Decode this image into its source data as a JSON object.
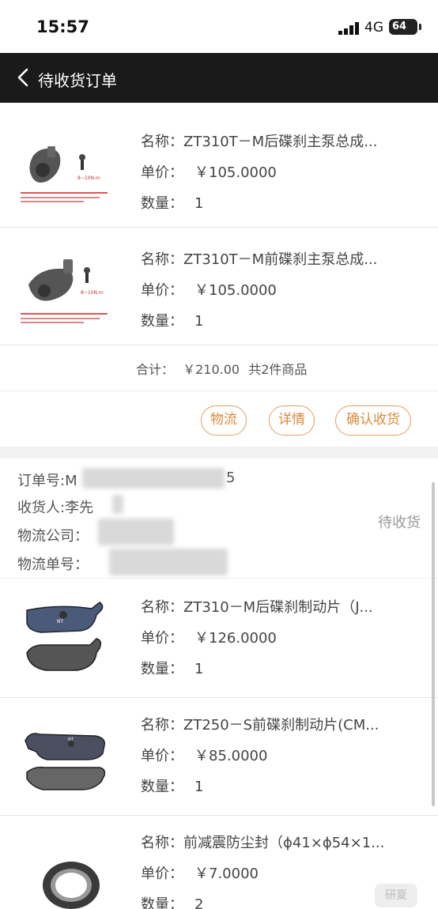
{
  "status_bar": {
    "time": "15:57",
    "network": "4G",
    "battery": "64"
  },
  "nav": {
    "title": "待收货订单"
  },
  "labels": {
    "name": "名称：",
    "price": "单价：",
    "qty": "数量："
  },
  "order1": {
    "items": [
      {
        "name": "ZT310T－M后碟刹主泵总成...",
        "price": "￥105.0000",
        "qty": "1"
      },
      {
        "name": "ZT310T－M前碟刹主泵总成...",
        "price": "￥105.0000",
        "qty": "1"
      }
    ],
    "total_label": "合计：",
    "total_value": "￥210.00",
    "count": "共2件商品",
    "buttons": {
      "logistics": "物流",
      "details": "详情",
      "confirm": "确认收货"
    }
  },
  "order2": {
    "order_no_label": "订单号:M",
    "order_no_suffix": "5",
    "receiver_label": "收货人:李先",
    "company_label": "物流公司：",
    "tracking_label": "物流单号：",
    "status": "待收货",
    "items": [
      {
        "name": "ZT310－M后碟刹制动片（J...",
        "price": "￥126.0000",
        "qty": "1"
      },
      {
        "name": "ZT250－S前碟刹制动片(CM...",
        "price": "￥85.0000",
        "qty": "1"
      },
      {
        "name": "前减震防尘封（ϕ41×ϕ54×1...",
        "price": "￥7.0000",
        "qty": "2"
      }
    ]
  },
  "watermark": "研夏"
}
